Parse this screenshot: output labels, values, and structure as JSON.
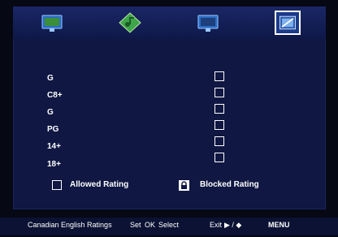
{
  "menu_tabs": [
    {
      "name": "picture",
      "icon": "picture-icon"
    },
    {
      "name": "audio",
      "icon": "audio-icon"
    },
    {
      "name": "setup",
      "icon": "tv-setup-icon"
    },
    {
      "name": "lock",
      "icon": "lock-screen-icon",
      "selected": true
    }
  ],
  "ratings": {
    "items": [
      {
        "label": "G",
        "blocked": false
      },
      {
        "label": "C8+",
        "blocked": false
      },
      {
        "label": "G",
        "blocked": false
      },
      {
        "label": "PG",
        "blocked": false
      },
      {
        "label": "14+",
        "blocked": false
      },
      {
        "label": "18+",
        "blocked": false
      }
    ]
  },
  "legend": {
    "allowed_label": "Allowed Rating",
    "blocked_label": "Blocked Rating"
  },
  "status": {
    "title": "Canadian English Ratings",
    "set_label": "Set",
    "ok_label": "OK",
    "select_label": "Select",
    "exit_label": "Exit",
    "nav_label": "▶ / ◆",
    "menu_label": "MENU"
  },
  "colors": {
    "background": "#060814",
    "panel": "#0f1742",
    "text": "#ffffff"
  }
}
